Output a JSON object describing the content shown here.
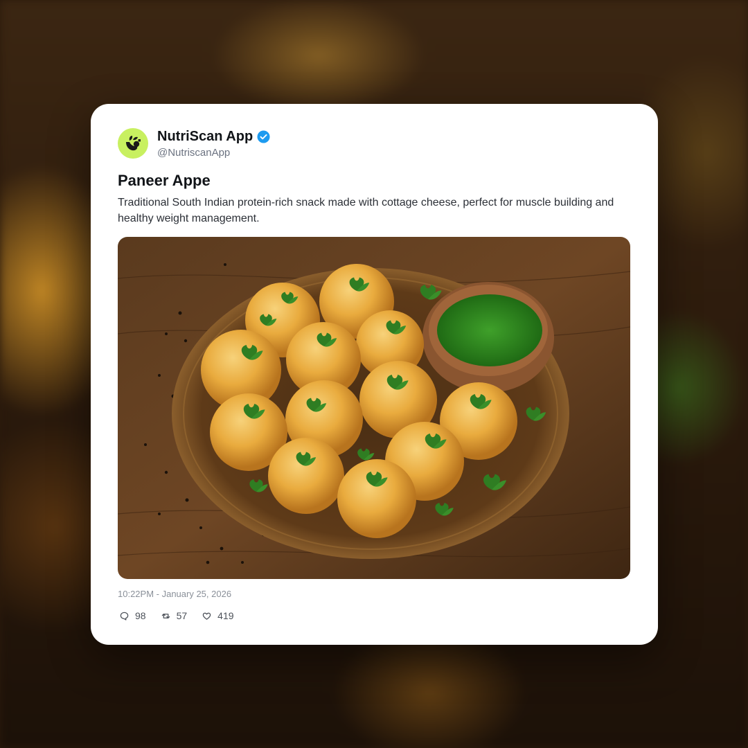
{
  "post": {
    "account_name": "NutriScan App",
    "handle": "@NutriscanApp",
    "verified": true,
    "title": "Paneer Appe",
    "description": "Traditional South Indian protein-rich snack made with cottage cheese, perfect for muscle building and healthy weight management.",
    "timestamp": "10:22PM - January 25, 2026",
    "stats": {
      "replies": "98",
      "reposts": "57",
      "likes": "419"
    }
  },
  "icons": {
    "avatar": "nutriscan-logo-icon",
    "verified": "verified-badge-icon",
    "reply": "comment-icon",
    "repost": "repost-icon",
    "like": "heart-icon"
  },
  "colors": {
    "avatar_bg": "#c8f060",
    "verified_blue": "#1d9bf0",
    "card_bg": "#ffffff"
  }
}
